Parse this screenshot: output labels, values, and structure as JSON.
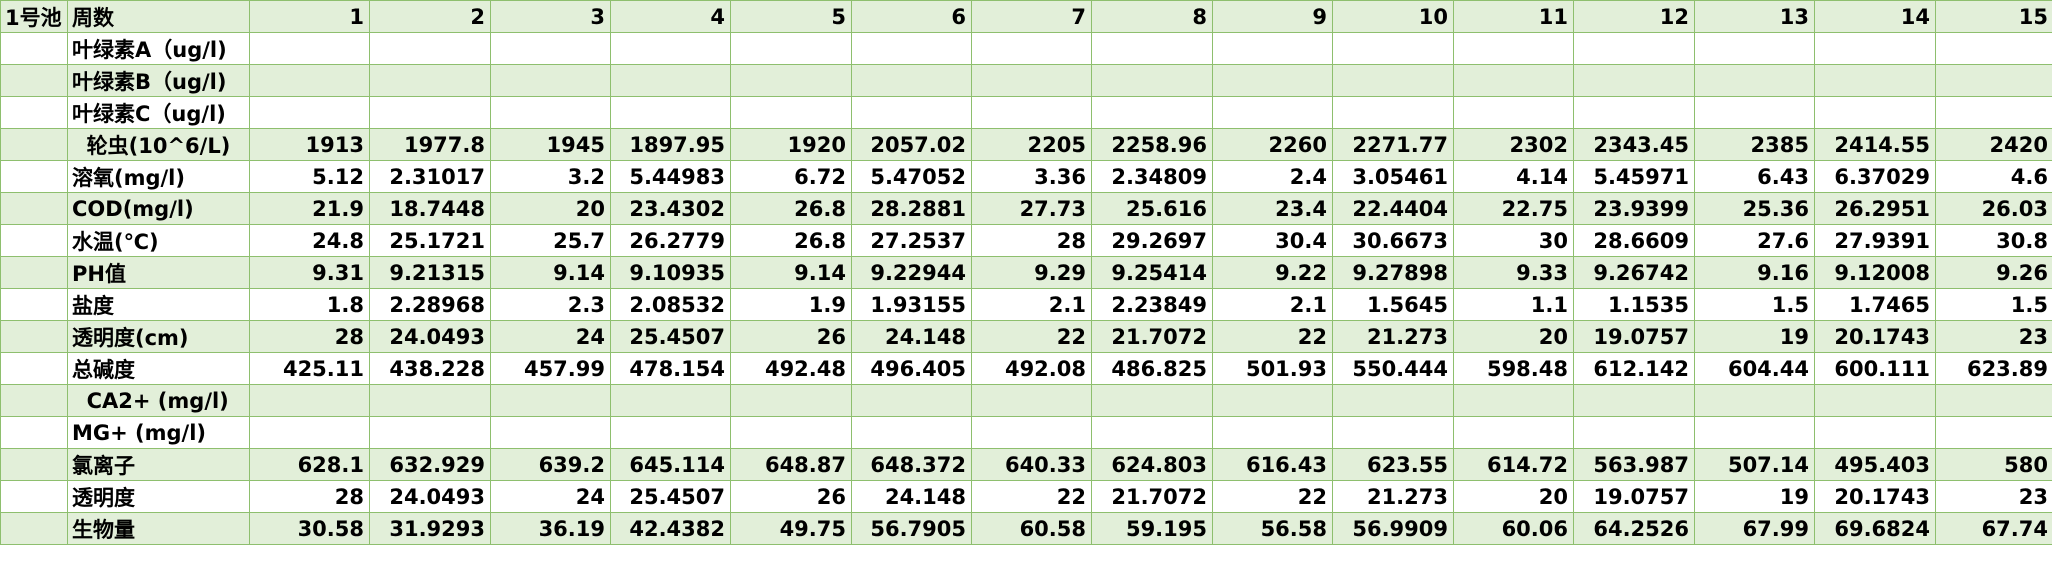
{
  "pond_label": "1号池",
  "header": {
    "label": "周数",
    "weeks": [
      "1",
      "2",
      "3",
      "4",
      "5",
      "6",
      "7",
      "8",
      "9",
      "10",
      "11",
      "12",
      "13",
      "14",
      "15"
    ]
  },
  "rows": [
    {
      "label": "叶绿素A（ug/l)",
      "values": [
        "",
        "",
        "",
        "",
        "",
        "",
        "",
        "",
        "",
        "",
        "",
        "",
        "",
        "",
        ""
      ]
    },
    {
      "label": "叶绿素B（ug/l)",
      "values": [
        "",
        "",
        "",
        "",
        "",
        "",
        "",
        "",
        "",
        "",
        "",
        "",
        "",
        "",
        ""
      ]
    },
    {
      "label": "叶绿素C（ug/l)",
      "values": [
        "",
        "",
        "",
        "",
        "",
        "",
        "",
        "",
        "",
        "",
        "",
        "",
        "",
        "",
        ""
      ]
    },
    {
      "label": "  轮虫(10^6/L)",
      "values": [
        "1913",
        "1977.8",
        "1945",
        "1897.95",
        "1920",
        "2057.02",
        "2205",
        "2258.96",
        "2260",
        "2271.77",
        "2302",
        "2343.45",
        "2385",
        "2414.55",
        "2420"
      ]
    },
    {
      "label": "溶氧(mg/l)",
      "values": [
        "5.12",
        "2.31017",
        "3.2",
        "5.44983",
        "6.72",
        "5.47052",
        "3.36",
        "2.34809",
        "2.4",
        "3.05461",
        "4.14",
        "5.45971",
        "6.43",
        "6.37029",
        "4.6"
      ]
    },
    {
      "label": "COD(mg/l)",
      "values": [
        "21.9",
        "18.7448",
        "20",
        "23.4302",
        "26.8",
        "28.2881",
        "27.73",
        "25.616",
        "23.4",
        "22.4404",
        "22.75",
        "23.9399",
        "25.36",
        "26.2951",
        "26.03"
      ]
    },
    {
      "label": "水温(℃)",
      "values": [
        "24.8",
        "25.1721",
        "25.7",
        "26.2779",
        "26.8",
        "27.2537",
        "28",
        "29.2697",
        "30.4",
        "30.6673",
        "30",
        "28.6609",
        "27.6",
        "27.9391",
        "30.8"
      ]
    },
    {
      "label": "PH值",
      "values": [
        "9.31",
        "9.21315",
        "9.14",
        "9.10935",
        "9.14",
        "9.22944",
        "9.29",
        "9.25414",
        "9.22",
        "9.27898",
        "9.33",
        "9.26742",
        "9.16",
        "9.12008",
        "9.26"
      ]
    },
    {
      "label": "盐度",
      "values": [
        "1.8",
        "2.28968",
        "2.3",
        "2.08532",
        "1.9",
        "1.93155",
        "2.1",
        "2.23849",
        "2.1",
        "1.5645",
        "1.1",
        "1.1535",
        "1.5",
        "1.7465",
        "1.5"
      ]
    },
    {
      "label": "透明度(cm)",
      "values": [
        "28",
        "24.0493",
        "24",
        "25.4507",
        "26",
        "24.148",
        "22",
        "21.7072",
        "22",
        "21.273",
        "20",
        "19.0757",
        "19",
        "20.1743",
        "23"
      ]
    },
    {
      "label": "总碱度",
      "values": [
        "425.11",
        "438.228",
        "457.99",
        "478.154",
        "492.48",
        "496.405",
        "492.08",
        "486.825",
        "501.93",
        "550.444",
        "598.48",
        "612.142",
        "604.44",
        "600.111",
        "623.89"
      ]
    },
    {
      "label": "  CA2+ (mg/l)",
      "values": [
        "",
        "",
        "",
        "",
        "",
        "",
        "",
        "",
        "",
        "",
        "",
        "",
        "",
        "",
        ""
      ]
    },
    {
      "label": "MG+ (mg/l)",
      "values": [
        "",
        "",
        "",
        "",
        "",
        "",
        "",
        "",
        "",
        "",
        "",
        "",
        "",
        "",
        ""
      ]
    },
    {
      "label": "氯离子",
      "values": [
        "628.1",
        "632.929",
        "639.2",
        "645.114",
        "648.87",
        "648.372",
        "640.33",
        "624.803",
        "616.43",
        "623.55",
        "614.72",
        "563.987",
        "507.14",
        "495.403",
        "580"
      ]
    },
    {
      "label": "透明度",
      "values": [
        "28",
        "24.0493",
        "24",
        "25.4507",
        "26",
        "24.148",
        "22",
        "21.7072",
        "22",
        "21.273",
        "20",
        "19.0757",
        "19",
        "20.1743",
        "23"
      ]
    },
    {
      "label": "生物量",
      "values": [
        "30.58",
        "31.9293",
        "36.19",
        "42.4382",
        "49.75",
        "56.7905",
        "60.58",
        "59.195",
        "56.58",
        "56.9909",
        "60.06",
        "64.2526",
        "67.99",
        "69.6824",
        "67.74"
      ]
    }
  ]
}
